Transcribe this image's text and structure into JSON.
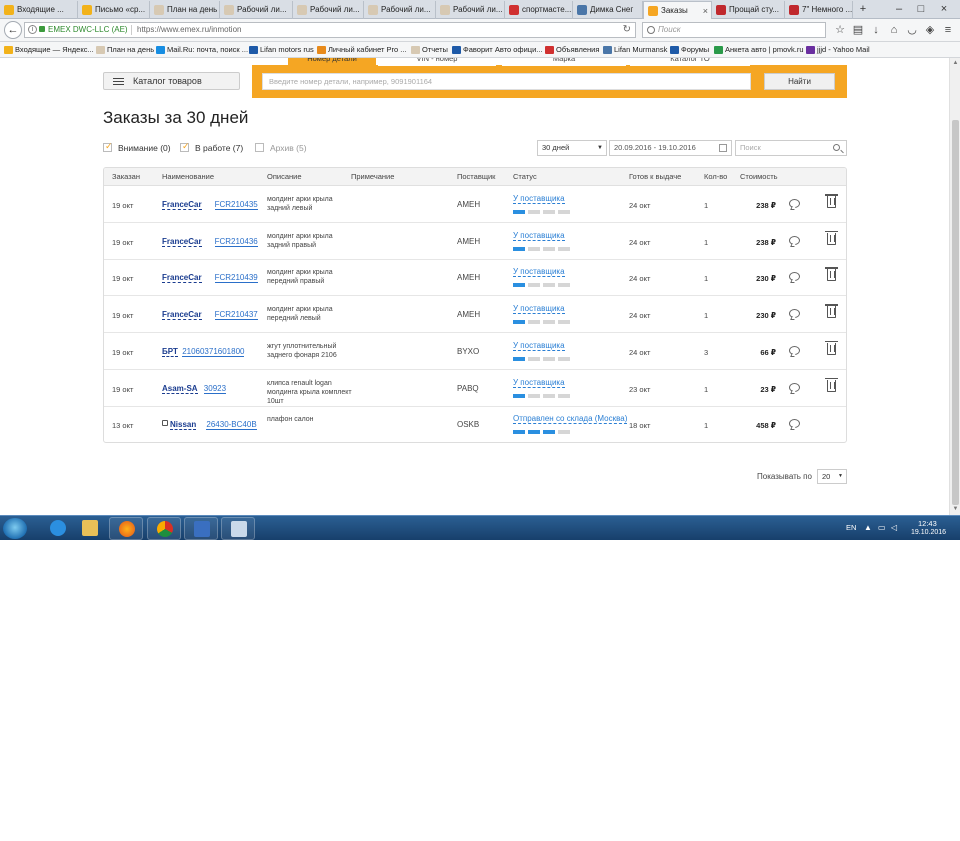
{
  "browser": {
    "tabs": [
      {
        "label": "Входящие ...",
        "color": "#f2b21a"
      },
      {
        "label": "Письмо «ср...",
        "color": "#f2b21a"
      },
      {
        "label": "План на день",
        "color": "#d7c9b3"
      },
      {
        "label": "Рабочий ли...",
        "color": "#d7c9b3"
      },
      {
        "label": "Рабочий ли...",
        "color": "#d7c9b3"
      },
      {
        "label": "Рабочий ли...",
        "color": "#d7c9b3"
      },
      {
        "label": "Рабочий ли...",
        "color": "#d7c9b3"
      },
      {
        "label": "спортмасте...",
        "color": "#d03030"
      },
      {
        "label": "Димка Снег",
        "color": "#4a76a8"
      },
      {
        "label": "Заказы",
        "color": "#f5a623"
      },
      {
        "label": "Прощай сту...",
        "color": "#c0282d"
      },
      {
        "label": "7\" Немного ...",
        "color": "#c0282d"
      }
    ],
    "new_tab_label": "+",
    "url_identity": "EMEX DWC-LLC (AE)",
    "url": "https://www.emex.ru/inmotion",
    "search_placeholder": "Поиск",
    "bookmarks": [
      {
        "label": "Входящие — Яндекс...",
        "color": "#f2b21a"
      },
      {
        "label": "План на день",
        "color": "#d7c9b3"
      },
      {
        "label": "Mail.Ru: почта, поиск ...",
        "color": "#168de2"
      },
      {
        "label": "Lifan motors rus",
        "color": "#1e5aa8"
      },
      {
        "label": "Личный кабинет Pro ...",
        "color": "#e88a1a"
      },
      {
        "label": "Отчеты",
        "color": "#d7c9b3"
      },
      {
        "label": "Фаворит Авто офици...",
        "color": "#1e5aa8"
      },
      {
        "label": "Объявления",
        "color": "#d03030"
      },
      {
        "label": "Lifan Murmansk",
        "color": "#4a76a8"
      },
      {
        "label": "Форумы",
        "color": "#1e5aa8"
      },
      {
        "label": "Анкета авто | pmovk.ru",
        "color": "#2a9a4a"
      },
      {
        "label": "jjjd - Yahoo Mail",
        "color": "#6a2fa0"
      }
    ]
  },
  "header": {
    "catalog_label": "Каталог товаров",
    "search_tabs": [
      "Номер детали",
      "VIN - номер",
      "Марка",
      "Каталог ТО"
    ],
    "part_placeholder": "Введите номер детали, например, 9091901164",
    "find_label": "Найти"
  },
  "main": {
    "title": "Заказы за 30 дней",
    "filters": {
      "attention": "Внимание (0)",
      "in_work": "В работе (7)",
      "archive": "Архив (5)"
    },
    "period": "30 дней",
    "date_range": "20.09.2016 - 19.10.2016",
    "search_placeholder": "Поиск",
    "columns": [
      "Заказан",
      "Наименование",
      "Описание",
      "Примечание",
      "Поставщик",
      "Статус",
      "Готов к выдаче",
      "Кол-во",
      "Стоимость"
    ],
    "orders": [
      {
        "date": "19 окт",
        "brand": "FranceCar",
        "part": "FCR210435",
        "desc": "молдинг арки крыла задний левый",
        "supplier": "AMEH",
        "status": "У поставщика",
        "progress": 1,
        "ready": "24 окт",
        "qty": "1",
        "price": "238 ₽",
        "locked": false
      },
      {
        "date": "19 окт",
        "brand": "FranceCar",
        "part": "FCR210436",
        "desc": "молдинг арки крыла задний правый",
        "supplier": "AMEH",
        "status": "У поставщика",
        "progress": 1,
        "ready": "24 окт",
        "qty": "1",
        "price": "238 ₽",
        "locked": false
      },
      {
        "date": "19 окт",
        "brand": "FranceCar",
        "part": "FCR210439",
        "desc": "молдинг арки крыла передний правый",
        "supplier": "AMEH",
        "status": "У поставщика",
        "progress": 1,
        "ready": "24 окт",
        "qty": "1",
        "price": "230 ₽",
        "locked": false
      },
      {
        "date": "19 окт",
        "brand": "FranceCar",
        "part": "FCR210437",
        "desc": "молдинг арки крыла передний левый",
        "supplier": "AMEH",
        "status": "У поставщика",
        "progress": 1,
        "ready": "24 окт",
        "qty": "1",
        "price": "230 ₽",
        "locked": false
      },
      {
        "date": "19 окт",
        "brand": "БРТ",
        "part": "21060371601800",
        "desc": "жгут уплотнительный заднего фонаря 2106",
        "supplier": "BYXO",
        "status": "У поставщика",
        "progress": 1,
        "ready": "24 окт",
        "qty": "3",
        "price": "66 ₽",
        "locked": false
      },
      {
        "date": "19 окт",
        "brand": "Asam-SA",
        "part": "30923",
        "desc": "клипса renault logan молдинга крыла комплект 10шт",
        "supplier": "PABQ",
        "status": "У поставщика",
        "progress": 1,
        "ready": "23 окт",
        "qty": "1",
        "price": "23 ₽",
        "locked": false
      },
      {
        "date": "13 окт",
        "brand": "Nissan",
        "part": "26430-BC40B",
        "desc": "плафон салон",
        "supplier": "OSKB",
        "status": "Отправлен со склада (Москва)",
        "progress": 3,
        "ready": "18 окт",
        "qty": "1",
        "price": "458 ₽",
        "locked": true
      }
    ],
    "per_page_label": "Показывать по",
    "per_page": "20"
  },
  "taskbar": {
    "lang": "EN",
    "time": "12:43",
    "date": "19.10.2016"
  }
}
